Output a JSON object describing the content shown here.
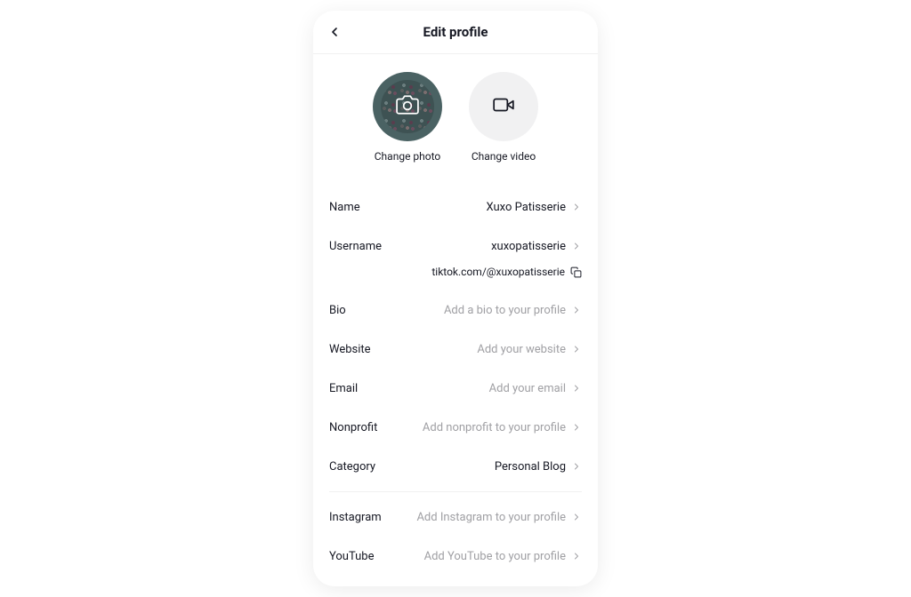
{
  "header": {
    "title": "Edit profile"
  },
  "media": {
    "photo_label": "Change photo",
    "video_label": "Change video"
  },
  "profile_url": "tiktok.com/@xuxopatisserie",
  "rows": {
    "name": {
      "label": "Name",
      "value": "Xuxo Patisserie",
      "placeholder": ""
    },
    "username": {
      "label": "Username",
      "value": "xuxopatisserie",
      "placeholder": ""
    },
    "bio": {
      "label": "Bio",
      "value": "",
      "placeholder": "Add a bio to your profile"
    },
    "website": {
      "label": "Website",
      "value": "",
      "placeholder": "Add your website"
    },
    "email": {
      "label": "Email",
      "value": "",
      "placeholder": "Add your email"
    },
    "nonprofit": {
      "label": "Nonprofit",
      "value": "",
      "placeholder": "Add nonprofit to your profile"
    },
    "category": {
      "label": "Category",
      "value": "Personal Blog",
      "placeholder": ""
    },
    "instagram": {
      "label": "Instagram",
      "value": "",
      "placeholder": "Add Instagram to your profile"
    },
    "youtube": {
      "label": "YouTube",
      "value": "",
      "placeholder": "Add YouTube to your profile"
    }
  }
}
